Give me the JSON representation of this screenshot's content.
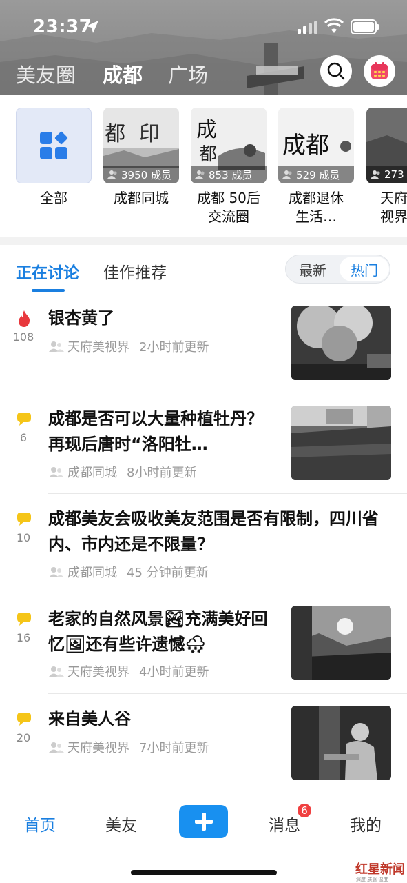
{
  "status_bar": {
    "time": "23:37"
  },
  "header": {
    "tabs": [
      {
        "label": "美友圈",
        "active": false
      },
      {
        "label": "成都",
        "active": true
      },
      {
        "label": "广场",
        "active": false
      }
    ]
  },
  "circles": [
    {
      "name": "全部",
      "members": ""
    },
    {
      "name": "成都同城",
      "members": "3950 成员"
    },
    {
      "name": "成都 50后\n交流圈",
      "members": "853 成员"
    },
    {
      "name": "成都退休\n生活…",
      "members": "529 成员"
    },
    {
      "name": "天府\n视界",
      "members": "273"
    }
  ],
  "sub_tabs": [
    {
      "label": "正在讨论",
      "active": true
    },
    {
      "label": "佳作推荐",
      "active": false
    }
  ],
  "sort_toggle": [
    {
      "label": "最新",
      "active": false
    },
    {
      "label": "热门",
      "active": true
    }
  ],
  "feed": [
    {
      "title": "银杏黄了",
      "icon": "fire-icon",
      "count": "108",
      "group": "天府美视界",
      "time": "2小时前更新",
      "has_image": true
    },
    {
      "title": "成都是否可以大量种植牡丹？再现后唐时“洛阳牡…",
      "icon": "comment-icon",
      "count": "6",
      "group": "成都同城",
      "time": "8小时前更新",
      "has_image": true
    },
    {
      "title": "成都美友会吸收美友范围是否有限制，四川省内、市内还是不限量？",
      "icon": "comment-icon",
      "count": "10",
      "group": "成都同城",
      "time": "45 分钟前更新",
      "has_image": false
    },
    {
      "title": "老家的自然风景🏞充满美好回忆🖼还有些许遗憾🌨",
      "icon": "comment-icon",
      "count": "16",
      "group": "天府美视界",
      "time": "4小时前更新",
      "has_image": true
    },
    {
      "title": "来自美人谷",
      "icon": "comment-icon",
      "count": "20",
      "group": "天府美视界",
      "time": "7小时前更新",
      "has_image": true
    }
  ],
  "bottom_nav": [
    {
      "label": "首页",
      "active": true
    },
    {
      "label": "美友",
      "active": false
    },
    {
      "label": "消息",
      "active": false,
      "badge": "6"
    },
    {
      "label": "我的",
      "active": false
    }
  ],
  "watermark": {
    "text": "红星新闻",
    "sub": "深度 质感 温度"
  },
  "colors": {
    "accent": "#1a7fe0",
    "fire": "#e8383d",
    "comment": "#f5c518",
    "badge": "#f04040"
  }
}
